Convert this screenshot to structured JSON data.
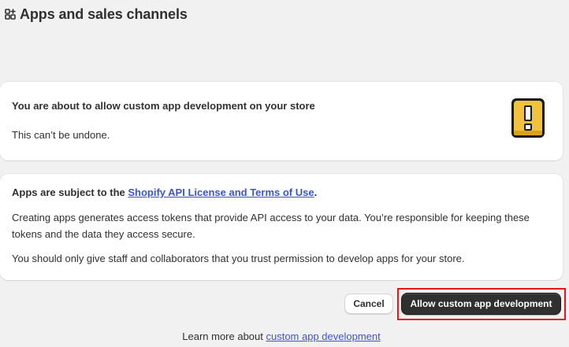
{
  "header": {
    "title": "Apps and sales channels",
    "icon": "apps-icon"
  },
  "warning_card": {
    "title": "You are about to allow custom app development on your store",
    "subtitle": "This can’t be undone.",
    "illustration": "exclamation-icon",
    "illustration_color": "#f2c23a"
  },
  "terms_card": {
    "heading_prefix": "Apps are subject to the ",
    "heading_link": "Shopify API License and Terms of Use",
    "heading_suffix": ".",
    "paragraph1": "Creating apps generates access tokens that provide API access to your data. You’re responsible for keeping these tokens and the data they access secure.",
    "paragraph2": "You should only give staff and collaborators that you trust permission to develop apps for your store."
  },
  "actions": {
    "cancel_label": "Cancel",
    "primary_label": "Allow custom app development",
    "highlight_color": "#e3151a"
  },
  "footer": {
    "prefix": "Learn more about ",
    "link": "custom app development"
  }
}
